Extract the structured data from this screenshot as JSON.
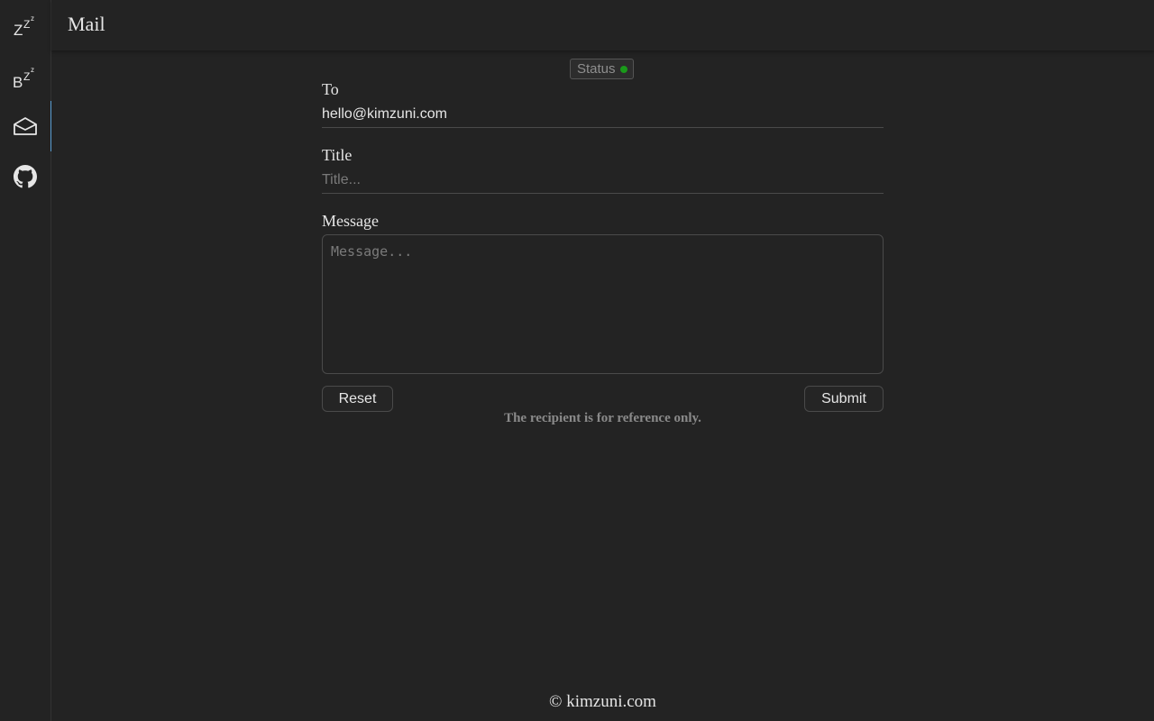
{
  "header": {
    "title": "Mail"
  },
  "sidebar": {
    "items": [
      {
        "name": "sleep-zzz-icon",
        "active": false
      },
      {
        "name": "bzz-icon",
        "active": false
      },
      {
        "name": "mail-icon",
        "active": true
      },
      {
        "name": "github-icon",
        "active": false
      }
    ]
  },
  "status": {
    "label": "Status",
    "state_color": "#1a9a1a"
  },
  "form": {
    "to": {
      "label": "To",
      "value": "hello@kimzuni.com"
    },
    "title": {
      "label": "Title",
      "placeholder": "Title..."
    },
    "message": {
      "label": "Message",
      "placeholder": "Message..."
    },
    "reset_label": "Reset",
    "submit_label": "Submit",
    "notice": "The recipient is for reference only."
  },
  "footer": {
    "text": "© kimzuni.com"
  },
  "colors": {
    "accent": "#5a9fd4",
    "background": "#232323"
  }
}
